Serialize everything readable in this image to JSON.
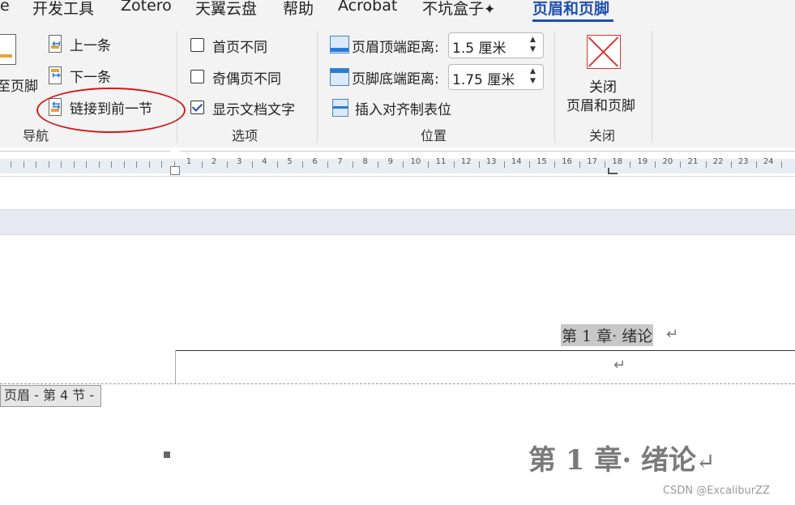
{
  "tabs": [
    {
      "label": "e"
    },
    {
      "label": "开发工具"
    },
    {
      "label": "Zotero"
    },
    {
      "label": "天翼云盘"
    },
    {
      "label": "帮助"
    },
    {
      "label": "Acrobat"
    },
    {
      "label": "不坑盒子"
    },
    {
      "label": "页眉和页脚"
    }
  ],
  "ribbon": {
    "nav": {
      "goto_partial": "至页脚",
      "prev": "上一条",
      "next": "下一条",
      "link_prev": "链接到前一节",
      "group_label": "导航"
    },
    "options": {
      "first_page_diff": "首页不同",
      "odd_even_diff": "奇偶页不同",
      "show_doc_text": "显示文档文字",
      "show_doc_text_checked": true,
      "group_label": "选项"
    },
    "position": {
      "header_top_label": "页眉顶端距离:",
      "header_top_value": "1.5 厘米",
      "footer_bottom_label": "页脚底端距离:",
      "footer_bottom_value": "1.75 厘米",
      "insert_align_tab": "插入对齐制表位",
      "group_label": "位置"
    },
    "close": {
      "button_line1": "关闭",
      "button_line2": "页眉和页脚",
      "group_label": "关闭"
    }
  },
  "ruler": {
    "numbers": [
      "1",
      "2",
      "3",
      "4",
      "5",
      "6",
      "7",
      "8",
      "9",
      "10",
      "11",
      "12",
      "13",
      "14",
      "15",
      "16",
      "17",
      "18",
      "19",
      "20",
      "21",
      "22",
      "23",
      "24"
    ]
  },
  "document": {
    "header_text": "第 1 章· 绪论",
    "paragraph_mark": "↵",
    "header_section_label": "页眉 - 第 4 节 -",
    "heading_text": "第 1 章· 绪论"
  },
  "watermark": "CSDN @ExcaliburZZ",
  "colors": {
    "accent": "#1f4fb3",
    "annotation_circle": "#d31a1a",
    "close_icon": "#d33333"
  }
}
